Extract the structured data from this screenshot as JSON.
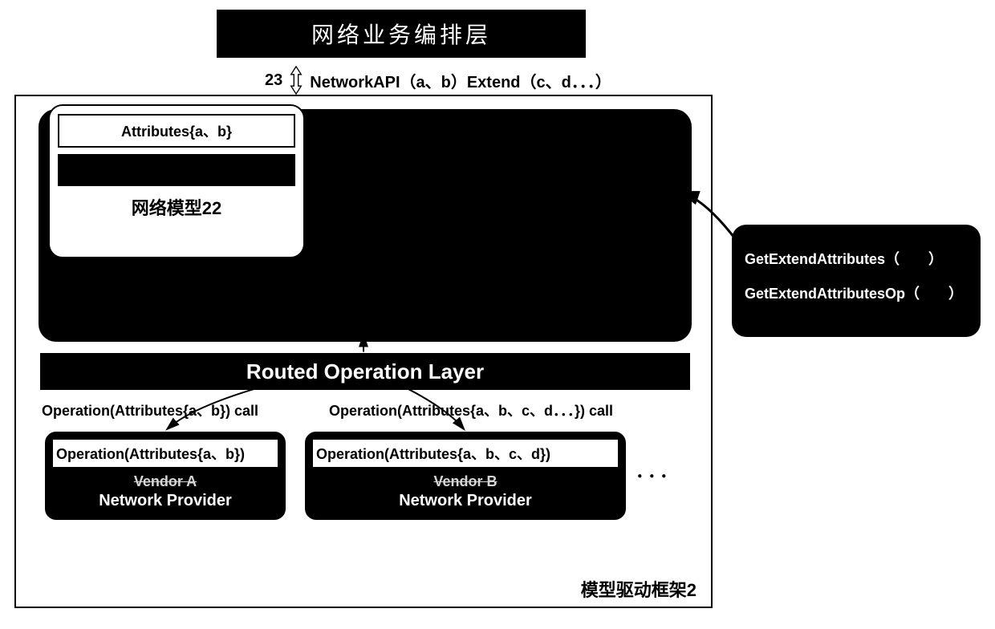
{
  "top_layer_label": "网络业务编排层",
  "api": {
    "num": "23",
    "text": "NetworkAPI（a、b）Extend（c、d．．．）"
  },
  "frame_label": "模型驱动框架2",
  "network_model": {
    "attributes_label": "Attributes{a、b}",
    "label": "网络模型22"
  },
  "routed_op_layer": "Routed Operation Layer",
  "calls": {
    "left": "Operation(Attributes{a、b}) call",
    "right": "Operation(Attributes{a、b、c、d．．．}) call"
  },
  "vendors": {
    "a": {
      "op": "Operation(Attributes{a、b})",
      "name": "Vendor A",
      "sub": "Network Provider"
    },
    "b": {
      "op": "Operation(Attributes{a、b、c、d})",
      "name": "Vendor B",
      "sub": "Network Provider"
    },
    "more": "．．．"
  },
  "extend_box": {
    "line1": "GetExtendAttributes（　　）",
    "line2": "GetExtendAttributesOp（　　）"
  }
}
